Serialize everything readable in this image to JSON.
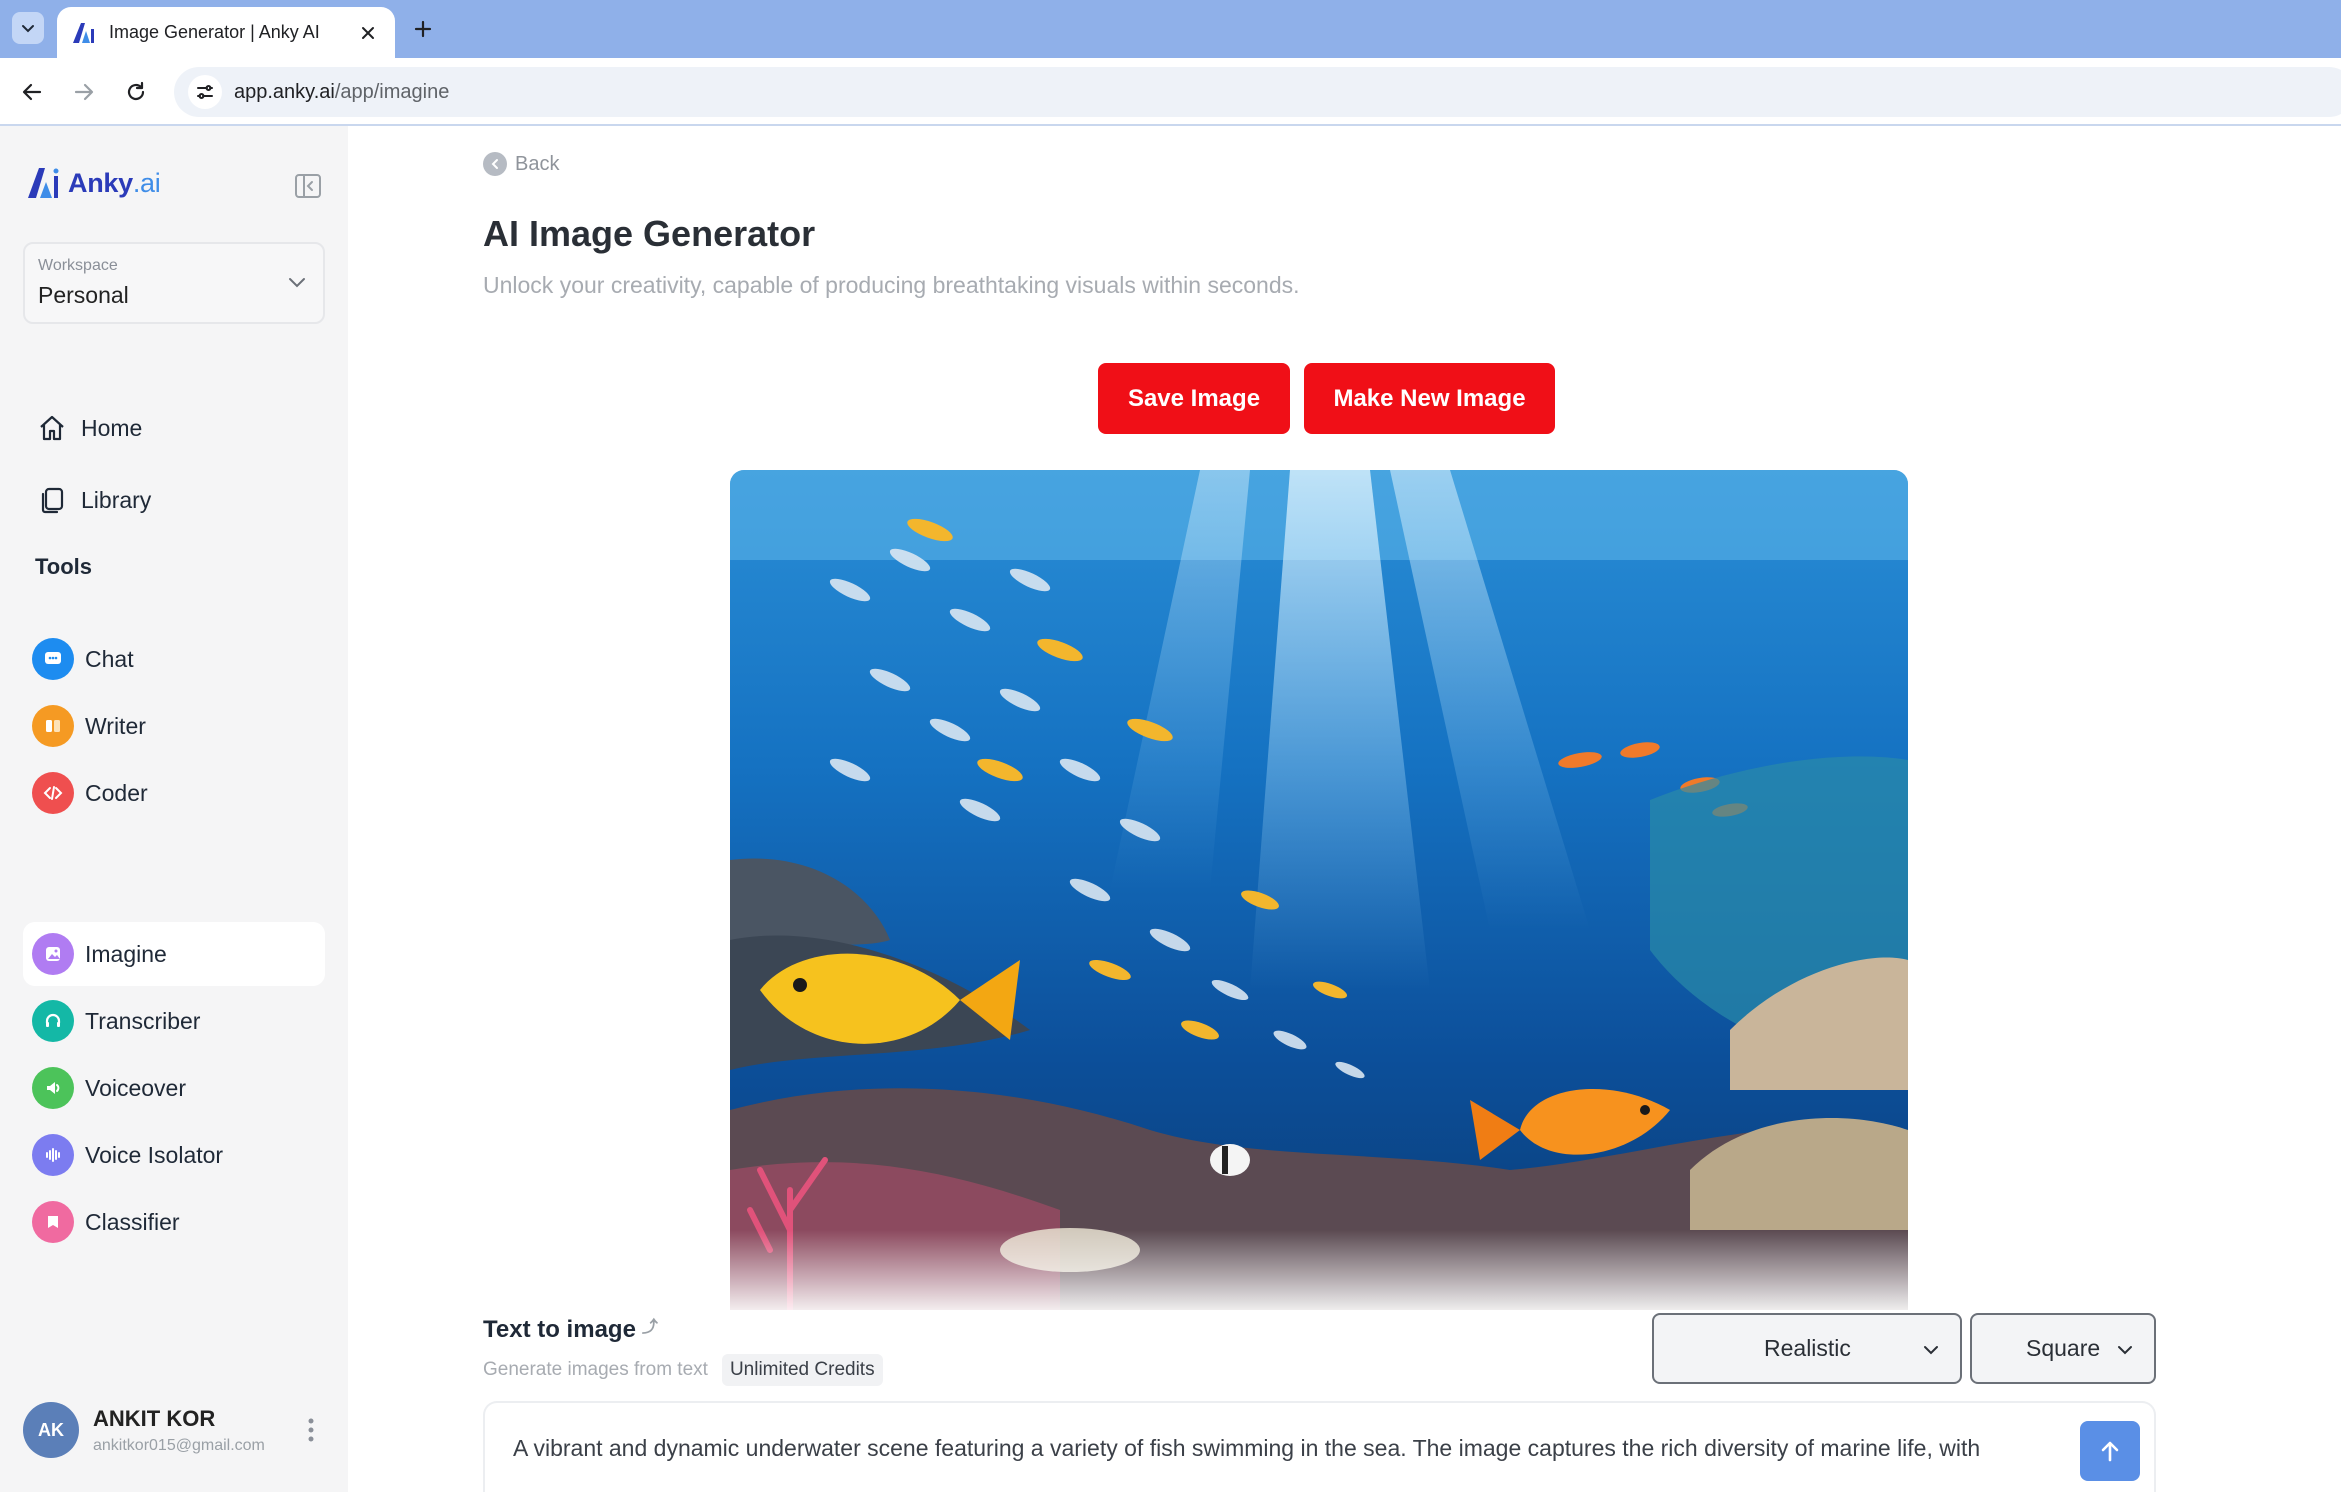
{
  "browser": {
    "tab_title": "Image Generator | Anky AI",
    "url_host": "app.anky.ai",
    "url_path": "/app/imagine"
  },
  "sidebar": {
    "brand": "Anky",
    "brand_suffix": ".ai",
    "workspace": {
      "label": "Workspace",
      "value": "Personal"
    },
    "nav": [
      {
        "label": "Home",
        "icon": "home-icon"
      },
      {
        "label": "Library",
        "icon": "library-icon"
      }
    ],
    "tools_heading": "Tools",
    "tools": [
      {
        "label": "Chat",
        "icon": "chat-icon",
        "color": "#1d8cf0"
      },
      {
        "label": "Writer",
        "icon": "writer-icon",
        "color": "#f59a23"
      },
      {
        "label": "Coder",
        "icon": "coder-icon",
        "color": "#ef4f4f"
      },
      {
        "label": "Imagine",
        "icon": "imagine-icon",
        "color": "#b07cf2",
        "active": true
      },
      {
        "label": "Transcriber",
        "icon": "transcriber-icon",
        "color": "#14b8a6"
      },
      {
        "label": "Voiceover",
        "icon": "voiceover-icon",
        "color": "#4cc35a"
      },
      {
        "label": "Voice Isolator",
        "icon": "voice-isolator-icon",
        "color": "#7c7cf0"
      },
      {
        "label": "Classifier",
        "icon": "classifier-icon",
        "color": "#f06aa0"
      }
    ],
    "user": {
      "initials": "AK",
      "name": "ANKIT KOR",
      "email": "ankitkor015@gmail.com"
    }
  },
  "main": {
    "back_label": "Back",
    "title": "AI Image Generator",
    "subtitle": "Unlock your creativity, capable of producing breathtaking visuals within seconds.",
    "save_button": "Save Image",
    "new_button": "Make New Image",
    "text_to_image": {
      "title": "Text to image",
      "superscript": "⤴",
      "description": "Generate images from text",
      "credits": "Unlimited Credits"
    },
    "style_select": "Realistic",
    "aspect_select": "Square",
    "prompt": "A vibrant and dynamic underwater scene featuring a variety of fish swimming in the sea. The image captures the rich diversity of marine life, with"
  },
  "colors": {
    "accent_red": "#f00f17",
    "send_blue": "#5a8fe6",
    "brand_blue": "#2b3bb9"
  }
}
